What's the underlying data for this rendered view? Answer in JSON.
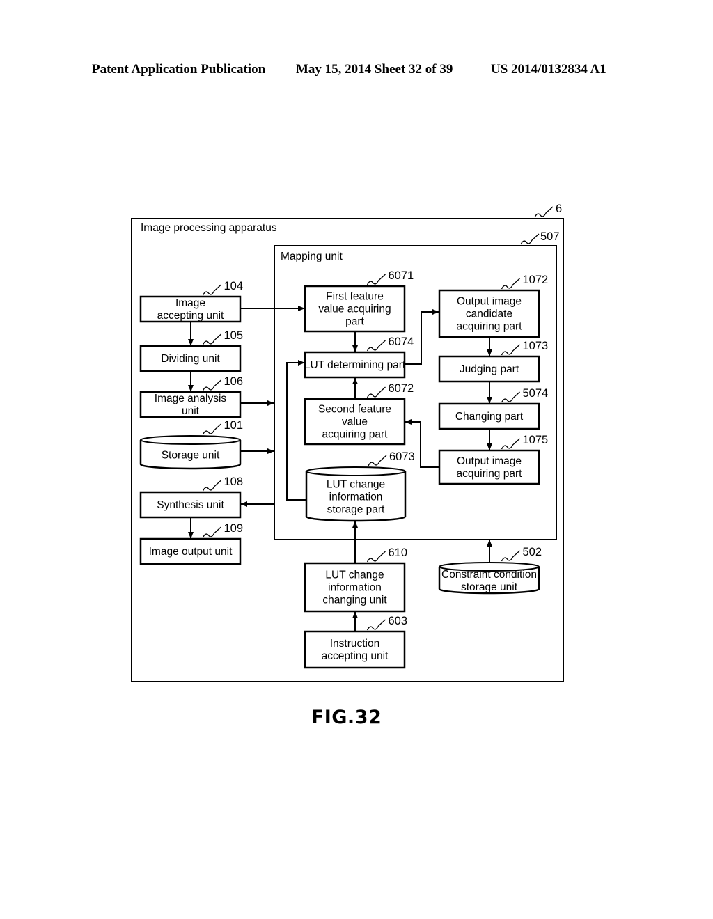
{
  "header": {
    "publication": "Patent Application Publication",
    "date_sheet": "May 15, 2014  Sheet 32 of 39",
    "number": "US 2014/0132834 A1"
  },
  "figure_label": "FIG.32",
  "apparatus": {
    "title": "Image processing apparatus",
    "ref": "6"
  },
  "mapping_unit": {
    "title": "Mapping unit",
    "ref": "507"
  },
  "blocks": {
    "image_accepting": {
      "lines": [
        "Image",
        "accepting unit"
      ],
      "ref": "104"
    },
    "dividing": {
      "lines": [
        "Dividing unit"
      ],
      "ref": "105"
    },
    "image_analysis": {
      "lines": [
        "Image analysis",
        "unit"
      ],
      "ref": "106"
    },
    "storage": {
      "lines": [
        "Storage unit"
      ],
      "ref": "101"
    },
    "synthesis": {
      "lines": [
        "Synthesis unit"
      ],
      "ref": "108"
    },
    "image_output": {
      "lines": [
        "Image output unit"
      ],
      "ref": "109"
    },
    "first_feature": {
      "lines": [
        "First feature",
        "value acquiring",
        "part"
      ],
      "ref": "6071"
    },
    "lut_determining": {
      "lines": [
        "LUT determining part"
      ],
      "ref": "6074"
    },
    "second_feature": {
      "lines": [
        "Second feature",
        "value",
        "acquiring part"
      ],
      "ref": "6072"
    },
    "lut_change_storage": {
      "lines": [
        "LUT change",
        "information",
        "storage part"
      ],
      "ref": "6073"
    },
    "output_candidate": {
      "lines": [
        "Output image",
        "candidate",
        "acquiring part"
      ],
      "ref": "1072"
    },
    "judging": {
      "lines": [
        "Judging part"
      ],
      "ref": "1073"
    },
    "changing": {
      "lines": [
        "Changing part"
      ],
      "ref": "5074"
    },
    "output_acquiring": {
      "lines": [
        "Output image",
        "acquiring part"
      ],
      "ref": "1075"
    },
    "lut_change_changing": {
      "lines": [
        "LUT change",
        "information",
        "changing unit"
      ],
      "ref": "610"
    },
    "instruction_accepting": {
      "lines": [
        "Instruction",
        "accepting unit"
      ],
      "ref": "603"
    },
    "constraint_storage": {
      "lines": [
        "Constraint condition",
        "storage unit"
      ],
      "ref": "502"
    }
  }
}
